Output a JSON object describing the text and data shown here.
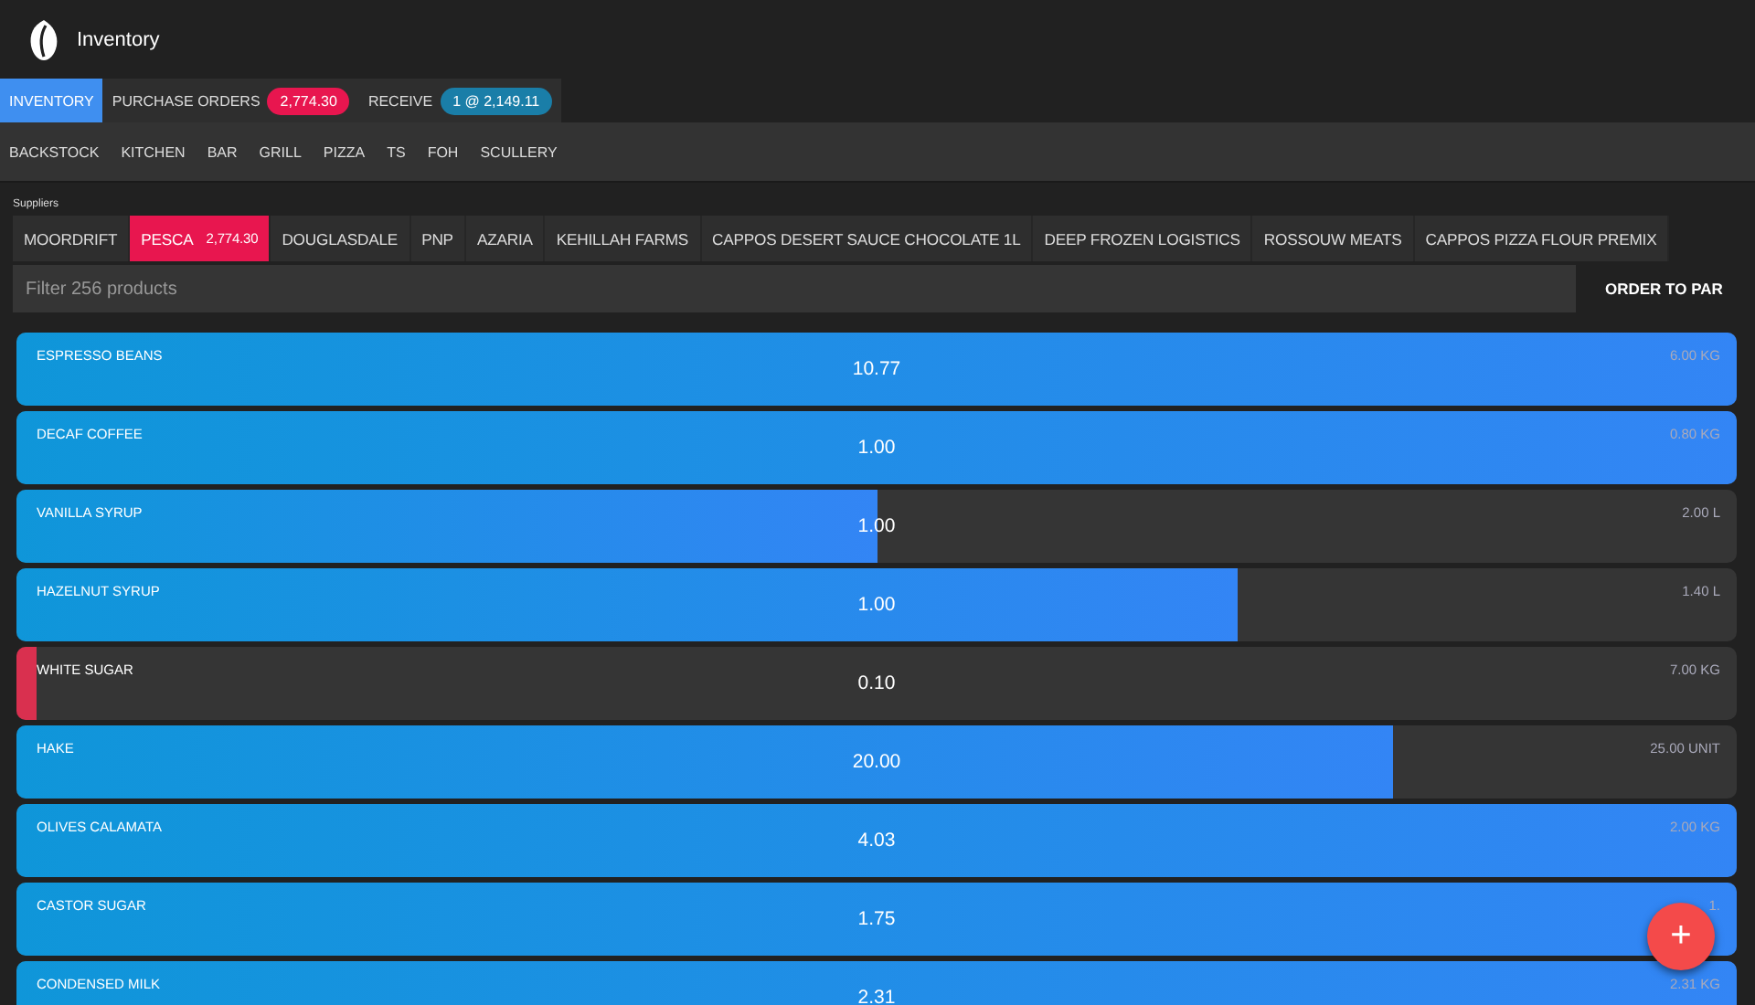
{
  "app_bar": {
    "title": "Inventory"
  },
  "tabs": [
    {
      "label": "INVENTORY",
      "selected": true
    },
    {
      "label": "PURCHASE ORDERS",
      "badge": "2,774.30",
      "color": "#e8164f",
      "selected": false
    },
    {
      "label": "RECEIVE",
      "badge": "1 @ 2,149.11",
      "color": "#1a7ea8",
      "selected": false
    }
  ],
  "locations": [
    "BACKSTOCK",
    "KITCHEN",
    "BAR",
    "GRILL",
    "PIZZA",
    "TS",
    "FOH",
    "SCULLERY"
  ],
  "suppliers_label": "Suppliers",
  "suppliers": [
    {
      "name": "MOORDRIFT",
      "selected": false
    },
    {
      "name": "PESCA",
      "amount": "2,774.30",
      "selected": true
    },
    {
      "name": "DOUGLASDALE",
      "selected": false
    },
    {
      "name": "PNP",
      "selected": false
    },
    {
      "name": "AZARIA",
      "selected": false
    },
    {
      "name": "KEHILLAH FARMS",
      "selected": false
    },
    {
      "name": "CAPPOS DESERT SAUCE CHOCOLATE 1L",
      "selected": false
    },
    {
      "name": "DEEP FROZEN LOGISTICS",
      "selected": false
    },
    {
      "name": "ROSSOUW MEATS",
      "selected": false
    },
    {
      "name": "CAPPOS PIZZA FLOUR PREMIX",
      "selected": false
    }
  ],
  "filter": {
    "placeholder": "Filter 256 products"
  },
  "order_button": "ORDER TO PAR",
  "products": [
    {
      "name": "ESPRESSO BEANS",
      "quantity": "10.77",
      "par": "6.00 KG",
      "level": 1,
      "low": false
    },
    {
      "name": "DECAF COFFEE",
      "quantity": "1.00",
      "par": "0.80 KG",
      "level": 1,
      "low": false
    },
    {
      "name": "VANILLA SYRUP",
      "quantity": "1.00",
      "par": "2.00 L",
      "level": 0.5,
      "low": false
    },
    {
      "name": "HAZELNUT SYRUP",
      "quantity": "1.00",
      "par": "1.40 L",
      "level": 0.71,
      "low": false
    },
    {
      "name": "WHITE SUGAR",
      "quantity": "0.10",
      "par": "7.00 KG",
      "level": 0.012,
      "low": true
    },
    {
      "name": "HAKE",
      "quantity": "20.00",
      "par": "25.00 UNIT",
      "level": 0.8,
      "low": false
    },
    {
      "name": "OLIVES CALAMATA",
      "quantity": "4.03",
      "par": "2.00 KG",
      "level": 1,
      "low": false
    },
    {
      "name": "CASTOR SUGAR",
      "quantity": "1.75",
      "par": "1.",
      "level": 1,
      "low": false
    },
    {
      "name": "CONDENSED MILK",
      "quantity": "2.31",
      "par": "2.31 KG",
      "level": 1,
      "low": false
    }
  ],
  "fab": "+"
}
